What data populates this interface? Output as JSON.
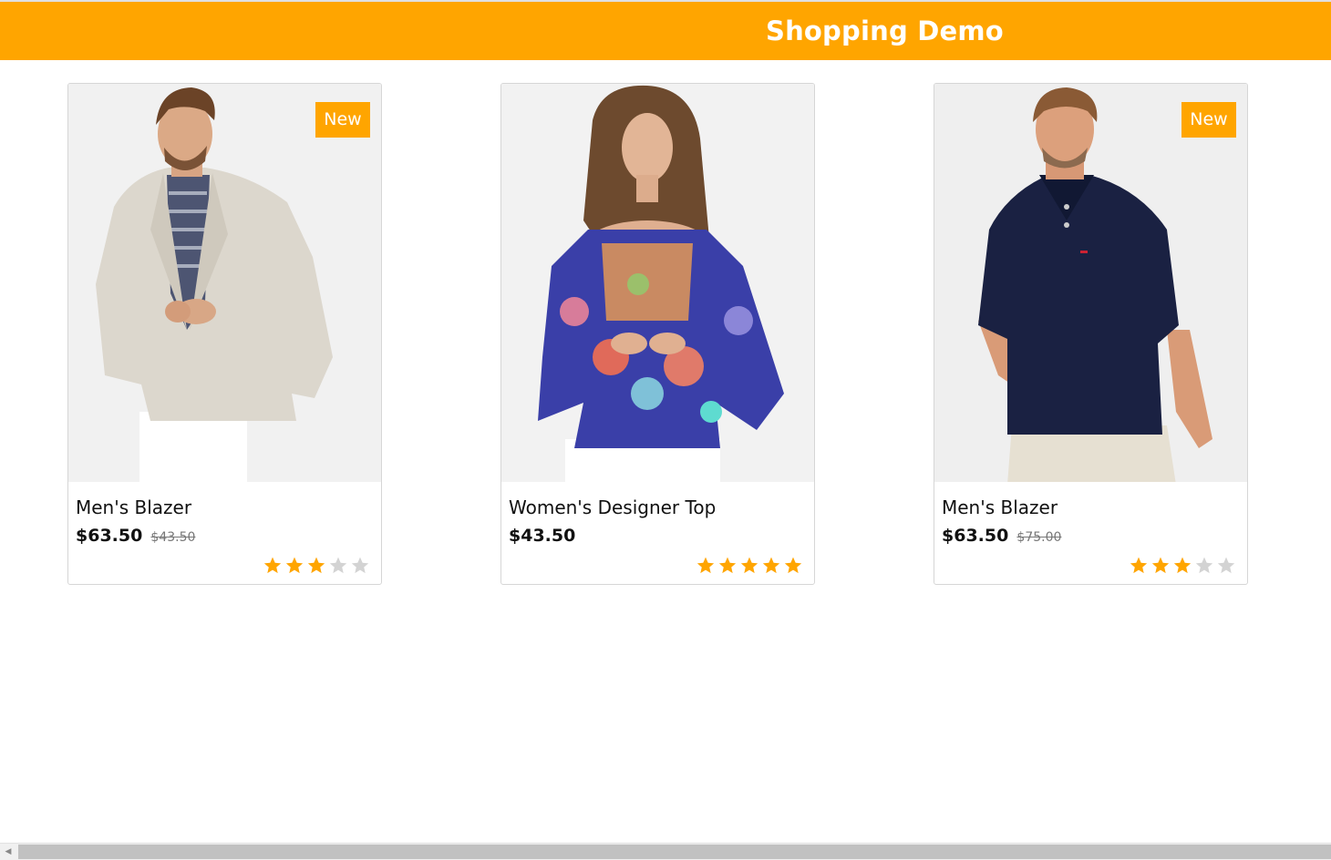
{
  "header": {
    "title": "Shopping Demo",
    "color": "#ffa500"
  },
  "products": [
    {
      "name": "Men's Blazer",
      "price": "$63.50",
      "old_price": "$43.50",
      "badge": "New",
      "rating": 3,
      "max_rating": 5,
      "image": "man-in-linen-blazer-image"
    },
    {
      "name": "Women's Designer Top",
      "price": "$43.50",
      "old_price": "",
      "badge": "",
      "rating": 5,
      "max_rating": 5,
      "image": "woman-in-floral-top-image"
    },
    {
      "name": "Men's Blazer",
      "price": "$63.50",
      "old_price": "$75.00",
      "badge": "New",
      "rating": 3,
      "max_rating": 5,
      "image": "man-in-navy-polo-image"
    }
  ],
  "colors": {
    "accent": "#ffa500",
    "star_on": "#ffa500",
    "star_off": "#d3d3d3"
  }
}
